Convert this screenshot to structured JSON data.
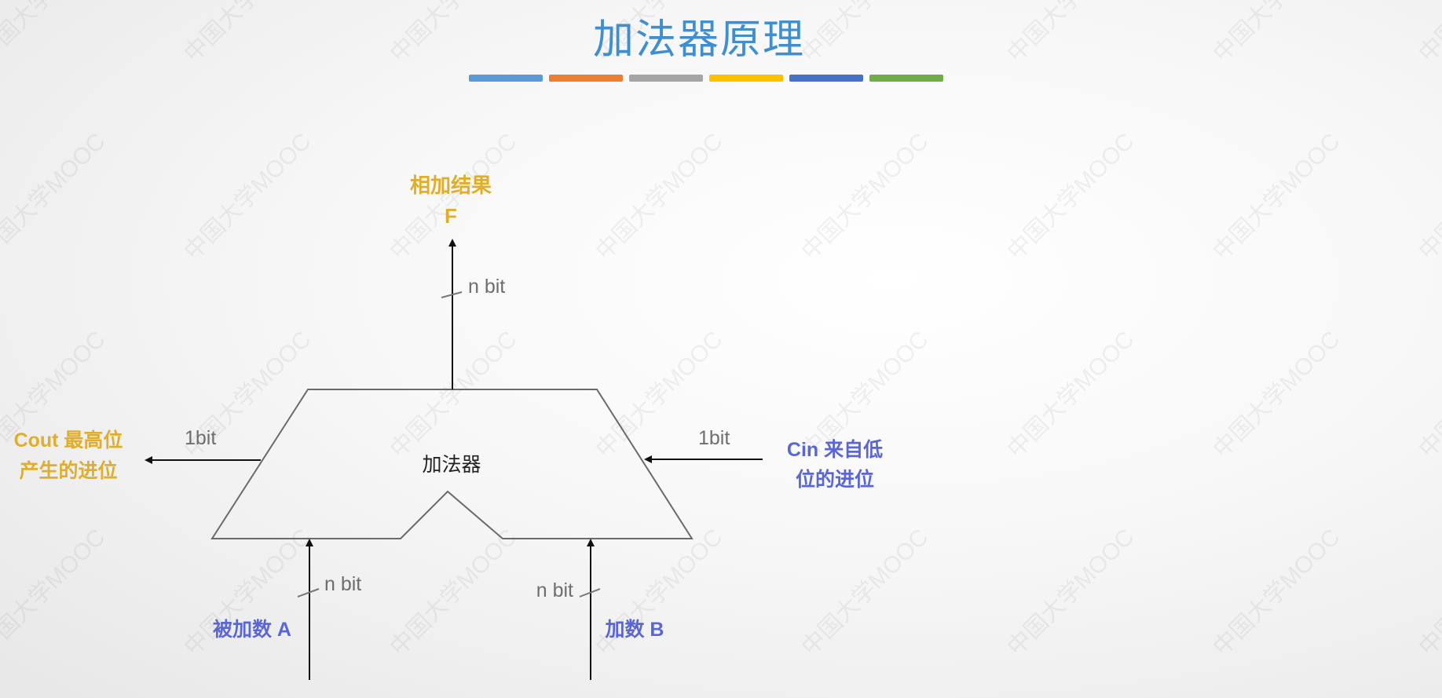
{
  "title": "加法器原理",
  "stripe_colors": [
    "#5b9bd5",
    "#ed7d31",
    "#a5a5a5",
    "#ffc000",
    "#4472c4",
    "#70ad47"
  ],
  "watermark_text": "中国大学MOOC",
  "diagram": {
    "block_label": "加法器",
    "output": {
      "label_line1": "相加结果",
      "label_line2": "F",
      "width_label": "n bit"
    },
    "cout": {
      "label_line1": "Cout 最高位",
      "label_line2": "产生的进位",
      "width_label": "1bit"
    },
    "cin": {
      "label_line1": "Cin 来自低",
      "label_line2": "位的进位",
      "width_label": "1bit"
    },
    "input_a": {
      "label": "被加数 A",
      "width_label": "n bit"
    },
    "input_b": {
      "label": "加数 B",
      "width_label": "n bit"
    }
  },
  "colors": {
    "title": "#3f8fd0",
    "highlight_yellow": "#e0ae2a",
    "highlight_blue": "#5a66d6",
    "line": "#555555"
  }
}
